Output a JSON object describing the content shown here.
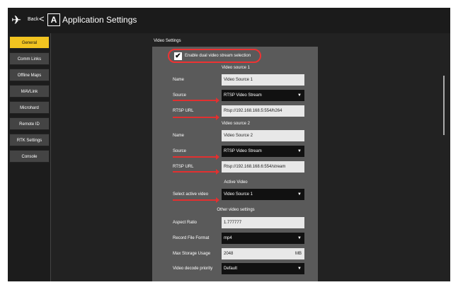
{
  "header": {
    "back_label": "Back",
    "back_chevron": "<",
    "title": "Application Settings",
    "icon_logo": "plane-logo-icon",
    "icon_app": "app-a-icon"
  },
  "sidebar": {
    "items": [
      {
        "label": "General",
        "active": true
      },
      {
        "label": "Comm Links",
        "active": false
      },
      {
        "label": "Offline Maps",
        "active": false
      },
      {
        "label": "MAVLink",
        "active": false
      },
      {
        "label": "Microhard",
        "active": false
      },
      {
        "label": "Remote ID",
        "active": false
      },
      {
        "label": "RTK Settings",
        "active": false
      },
      {
        "label": "Console",
        "active": false
      }
    ]
  },
  "video_settings": {
    "section_title": "Video Settings",
    "dual_checkbox_label": "Enable dual video stream selection",
    "dual_checked": true,
    "source1": {
      "header": "Video source 1",
      "name_label": "Name",
      "name_value": "Video Source 1",
      "source_label": "Source",
      "source_value": "RTSP Video Stream",
      "url_label": "RTSP URL",
      "url_value": "Rtsp://192.168.168.5:554/h264"
    },
    "source2": {
      "header": "Video source 2",
      "name_label": "Name",
      "name_value": "Video Source 2",
      "source_label": "Source",
      "source_value": "RTSP Video Stream",
      "url_label": "RTSP URL",
      "url_value": "Rtsp://192.168.168.6:554/stream"
    },
    "active": {
      "header": "Active Video",
      "label": "Select active video",
      "value": "Video Source 1"
    },
    "other": {
      "header": "Other video settings",
      "aspect_label": "Aspect Ratio",
      "aspect_value": "1.777777",
      "format_label": "Record File Format",
      "format_value": "mp4",
      "storage_label": "Max Storage Usage",
      "storage_value": "2048",
      "storage_unit": "MB",
      "decode_label": "Video decode priority",
      "decode_value": "Default"
    }
  },
  "colors": {
    "accent": "#f2c420",
    "annotation": "#e23030"
  }
}
